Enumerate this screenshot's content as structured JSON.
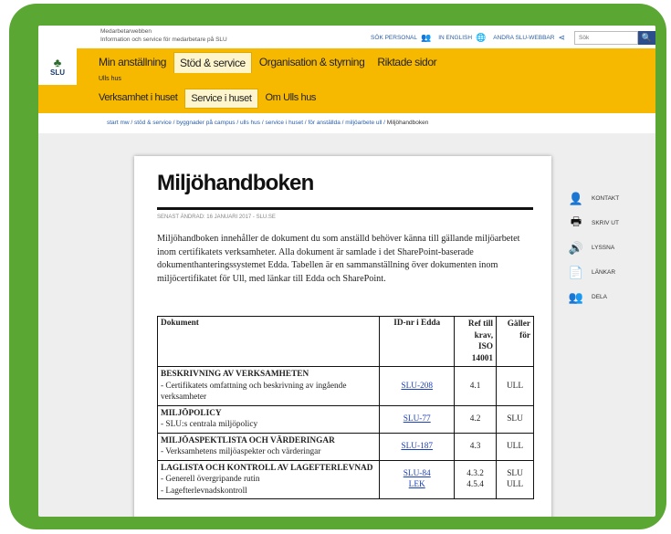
{
  "site": {
    "name_line1": "Medarbetarwebben",
    "name_line2": "Information och service för medarbetare på SLU"
  },
  "utility": {
    "items": [
      {
        "label": "SÖK PERSONAL",
        "icon": "people-icon",
        "glyph": "👥"
      },
      {
        "label": "IN ENGLISH",
        "icon": "globe-icon",
        "glyph": "🌐"
      },
      {
        "label": "ANDRA SLU-WEBBAR",
        "icon": "share-icon",
        "glyph": "⋖"
      }
    ],
    "search_placeholder": "Sök",
    "search_button_glyph": "🔍"
  },
  "logo": {
    "text": "SLU",
    "glyph": "♣"
  },
  "nav": {
    "main": [
      "Min anställning",
      "Stöd & service",
      "Organisation & styrning",
      "Riktade sidor"
    ],
    "section_label": "Ulls hus",
    "sub": [
      "Verksamhet i huset",
      "Service i huset",
      "Om Ulls hus"
    ]
  },
  "breadcrumb": {
    "links": [
      "start mw",
      "stöd & service",
      "byggnader på campus",
      "ulls hus",
      "service i huset",
      "för anställda",
      "miljöarbete ull"
    ],
    "separator": " / ",
    "current": "Miljöhandboken"
  },
  "article": {
    "title": "Miljöhandboken",
    "updated": "SENAST ÄNDRAD: 16 JANUARI 2017 - SLU.SE",
    "intro": "Miljöhandboken innehåller de dokument du som anställd behöver känna till gällande miljöarbetet inom certifikatets verksamheter. Alla dokument är samlade i det SharePoint-baserade dokumenthanteringssystemet Edda. Tabellen är en sammanställning över dokumenten inom miljöcertifikatet för Ull, med länkar till Edda och SharePoint.",
    "table": {
      "headers": {
        "doc": "Dokument",
        "id": "ID-nr i Edda",
        "ref_1": "Ref till",
        "ref_2": "krav,",
        "ref_3": "ISO 14001",
        "for_1": "Gäller",
        "for_2": "för"
      },
      "rows": [
        {
          "section": "BESKRIVNING AV VERKSAMHETEN",
          "items": [
            "- Certifikatets omfattning och beskrivning av ingående verksamheter"
          ],
          "ids": [
            "SLU-208"
          ],
          "refs": [
            "4.1"
          ],
          "applies": [
            "ULL"
          ]
        },
        {
          "section": "MILJÖPOLICY",
          "items": [
            "- SLU:s centrala miljöpolicy"
          ],
          "ids": [
            "SLU-77"
          ],
          "refs": [
            "4.2"
          ],
          "applies": [
            "SLU"
          ]
        },
        {
          "section": "MILJÖASPEKTLISTA OCH VÄRDERINGAR",
          "items": [
            "- Verksamhetens miljöaspekter och värderingar"
          ],
          "ids": [
            "SLU-187"
          ],
          "refs": [
            "4.3"
          ],
          "applies": [
            "ULL"
          ]
        },
        {
          "section": "LAGLISTA OCH KONTROLL AV LAGEFTERLEVNAD",
          "items": [
            "- Generell övergripande rutin",
            "- Lagefterlevnadskontroll"
          ],
          "ids": [
            "SLU-84",
            "LEK"
          ],
          "refs": [
            "4.3.2",
            "4.5.4"
          ],
          "applies": [
            "SLU",
            "ULL"
          ]
        }
      ]
    }
  },
  "tools": [
    {
      "label": "KONTAKT",
      "icon": "person-icon",
      "glyph": "👤"
    },
    {
      "label": "SKRIV UT",
      "icon": "print-icon",
      "glyph": "🖶"
    },
    {
      "label": "LYSSNA",
      "icon": "speaker-icon",
      "glyph": "🔊"
    },
    {
      "label": "LÄNKAR",
      "icon": "document-icon",
      "glyph": "📄"
    },
    {
      "label": "DELA",
      "icon": "group-icon",
      "glyph": "👥"
    }
  ],
  "colors": {
    "frame": "#5aa833",
    "nav_yellow": "#f7b800",
    "link_blue": "#2b5ea6",
    "search_button": "#2b4e8c"
  }
}
